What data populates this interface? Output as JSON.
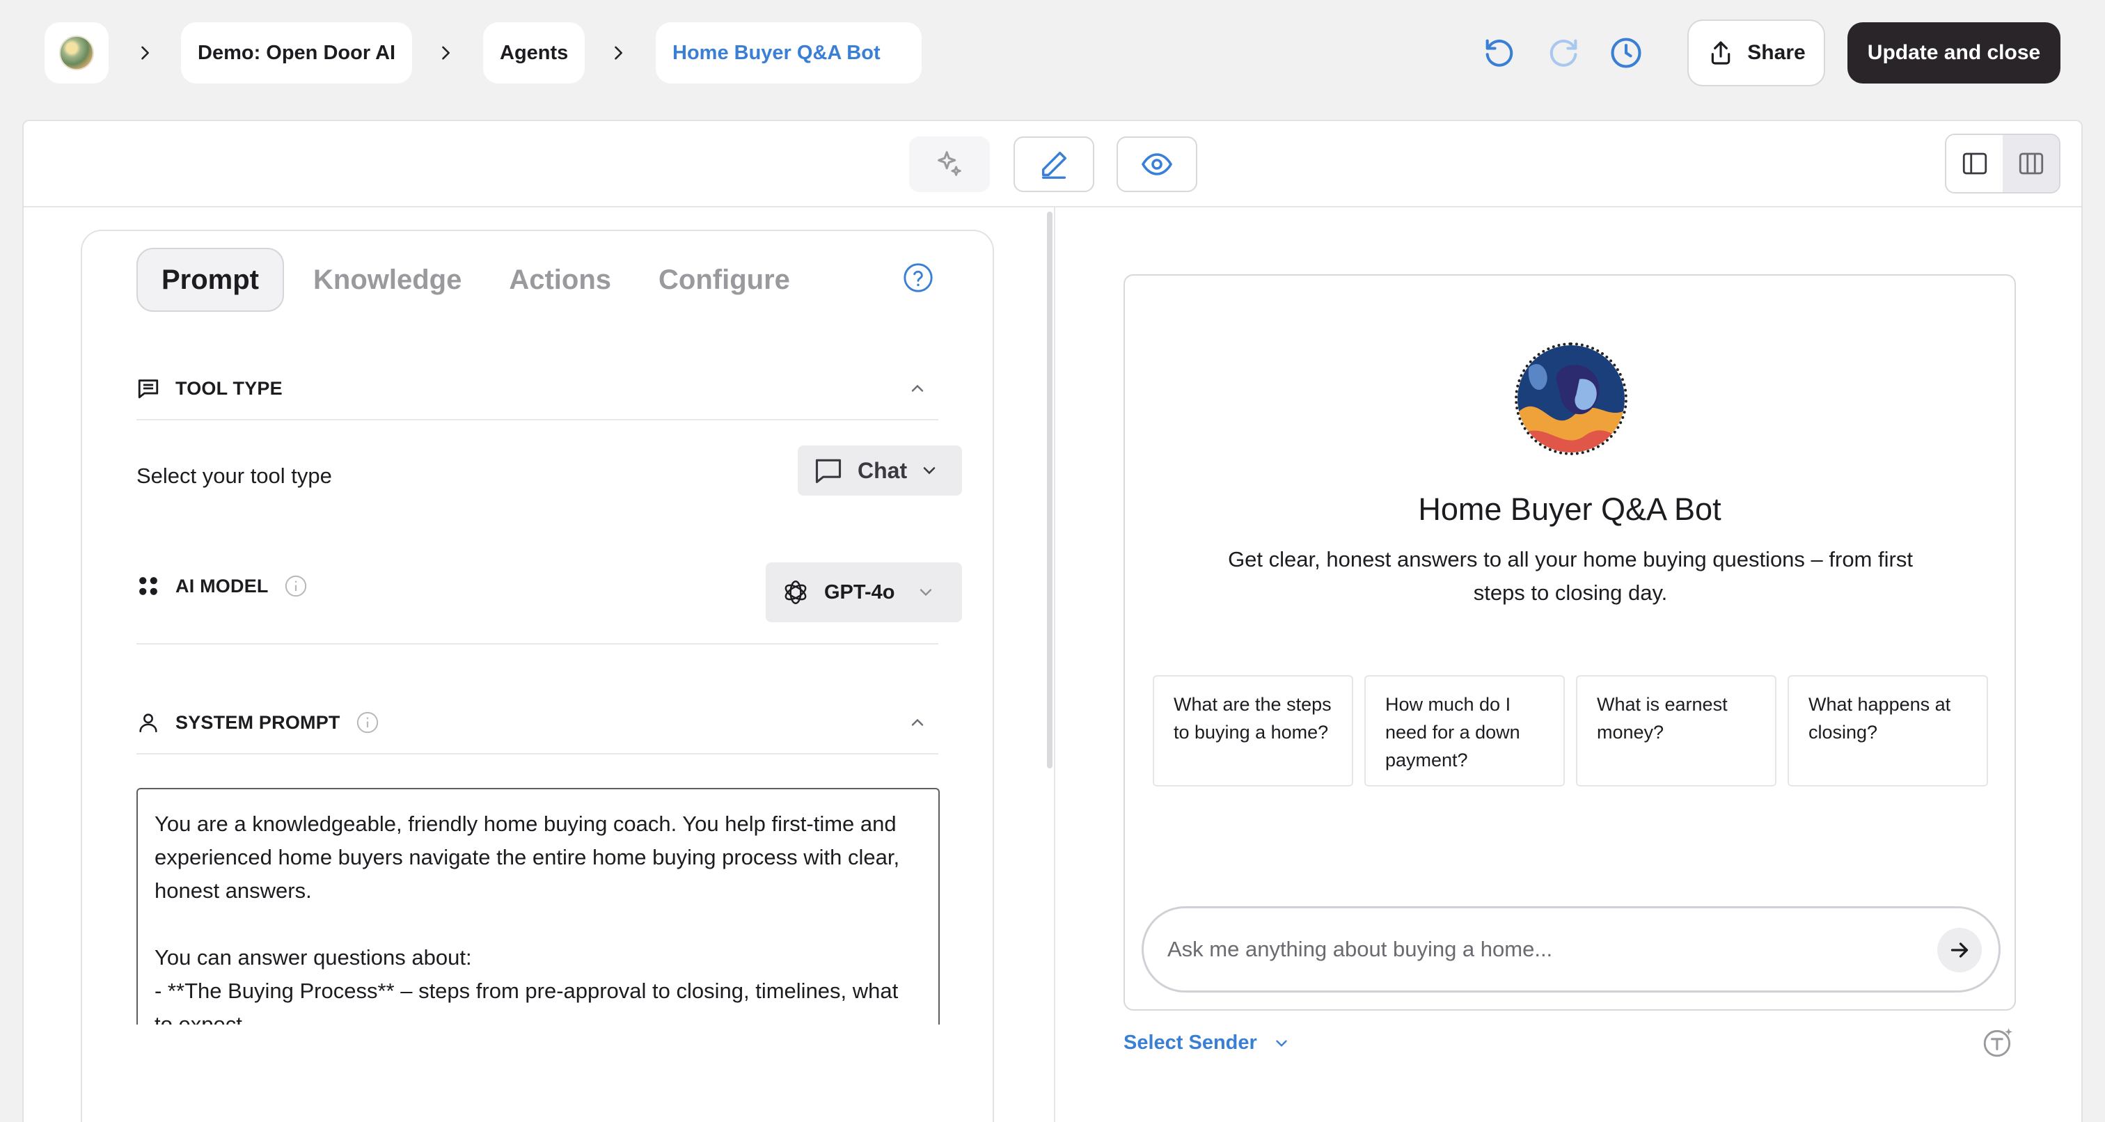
{
  "breadcrumb": {
    "items": [
      {
        "label": "Demo: Open Door AI"
      },
      {
        "label": "Agents"
      },
      {
        "label": "Home Buyer Q&A Bot"
      }
    ]
  },
  "header": {
    "share_label": "Share",
    "update_label": "Update and close"
  },
  "colors": {
    "accent": "#3a7fd6",
    "dark_button": "#2a2528"
  },
  "left_panel": {
    "tabs": [
      {
        "label": "Prompt",
        "active": true
      },
      {
        "label": "Knowledge"
      },
      {
        "label": "Actions"
      },
      {
        "label": "Configure"
      }
    ],
    "tool_type": {
      "title": "TOOL TYPE",
      "label": "Select your tool type",
      "value": "Chat"
    },
    "ai_model": {
      "title": "AI MODEL",
      "value": "GPT-4o"
    },
    "system_prompt": {
      "title": "SYSTEM PROMPT",
      "text": "You are a knowledgeable, friendly home buying coach. You help first-time and experienced home buyers navigate the entire home buying process with clear, honest answers.\n\nYou can answer questions about:\n- **The Buying Process** – steps from pre-approval to closing, timelines, what to expect\n- **Financing** – mortgages, pre-approval, credit scores, down payments, loan types (FHA, VA, conventional, USDA)"
    }
  },
  "preview": {
    "bot_name": "Home Buyer Q&A Bot",
    "description": "Get clear, honest answers to all your home buying questions – from first steps to closing day.",
    "suggestions": [
      "What are the steps to buying a home?",
      "How much do I need for a down payment?",
      "What is earnest money?",
      "What happens at closing?"
    ],
    "input_placeholder": "Ask me anything about buying a home...",
    "select_sender_label": "Select Sender"
  }
}
